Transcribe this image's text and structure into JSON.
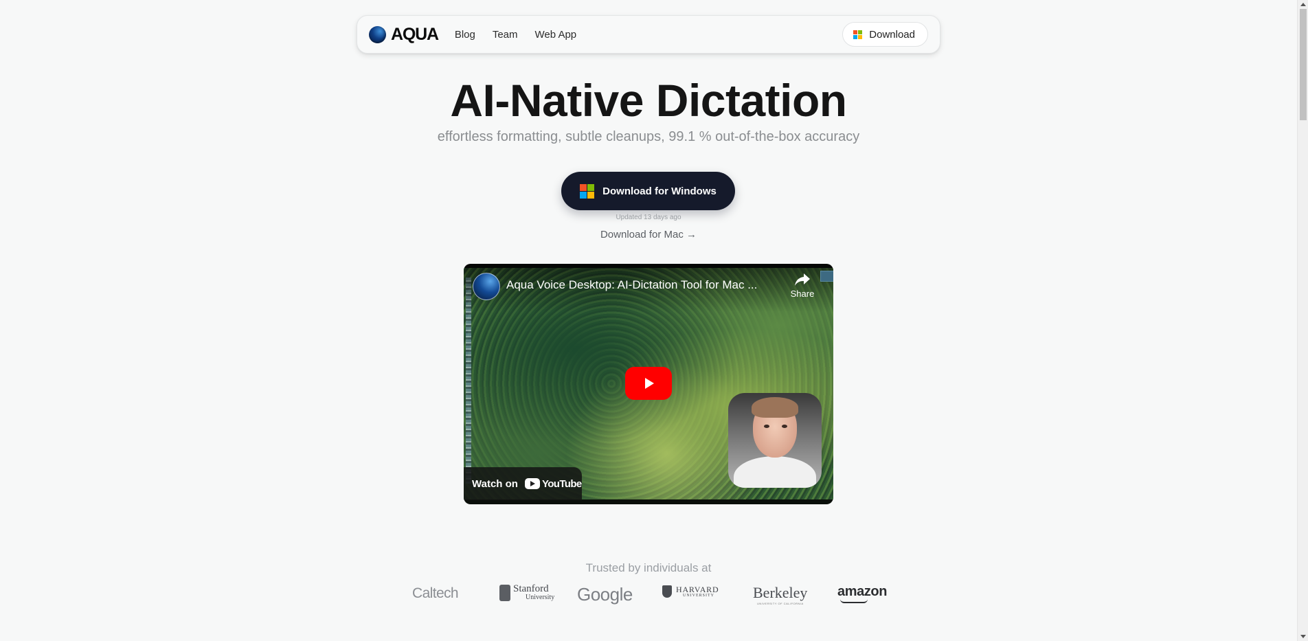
{
  "nav": {
    "logo_text": "AQUA",
    "links": [
      "Blog",
      "Team",
      "Web App"
    ],
    "download_label": "Download"
  },
  "hero": {
    "title": "AI-Native Dictation",
    "subtitle": "effortless formatting, subtle cleanups, 99.1 % out-of-the-box accuracy",
    "cta_label": "Download for Windows",
    "updated_text": "Updated 13 days ago",
    "mac_link": "Download for Mac →"
  },
  "video": {
    "title": "Aqua Voice Desktop: AI-Dictation Tool for Mac ...",
    "share_label": "Share",
    "watch_on": "Watch on",
    "youtube_text": "YouTube"
  },
  "trusted": {
    "heading": "Trusted by individuals at",
    "logos": {
      "caltech": "Caltech",
      "stanford_a": "Stanford",
      "stanford_b": "University",
      "google": "Google",
      "harvard_a": "HARVARD",
      "harvard_b": "UNIVERSITY",
      "berkeley": "Berkeley",
      "berkeley_sub": "UNIVERSITY OF CALIFORNIA",
      "amazon": "amazon"
    }
  },
  "colors": {
    "background": "#f7f8f8",
    "cta_bg": "#151a2b",
    "youtube_red": "#ff0000",
    "win_red": "#f35325",
    "win_green": "#81bc06",
    "win_blue": "#05a6f0",
    "win_yellow": "#ffba08"
  },
  "icons": {
    "logo": "aqua-orb-icon",
    "windows": "windows-logo-icon",
    "play": "youtube-play-icon",
    "share": "share-arrow-icon"
  }
}
